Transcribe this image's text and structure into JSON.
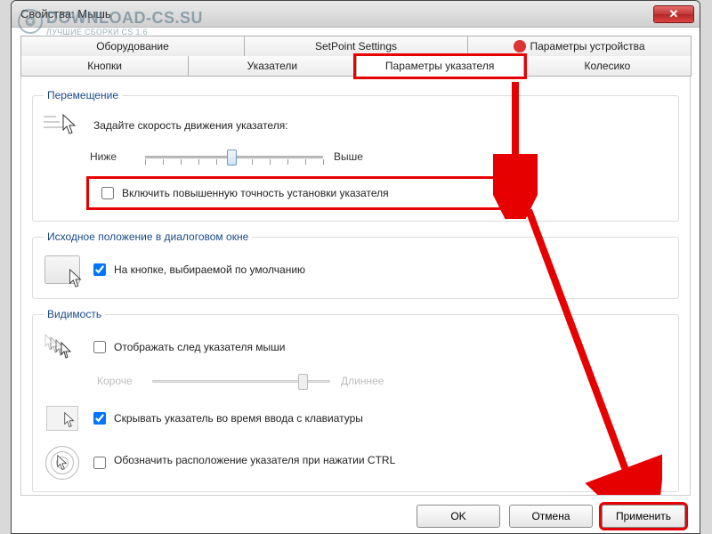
{
  "watermark": {
    "main": "DOWNLOAD-CS.SU",
    "sub": "ЛУЧШИЕ СБОРКИ CS 1.6"
  },
  "window": {
    "title": "Свойства: Мышь"
  },
  "tabs_row1": [
    {
      "label": "Оборудование"
    },
    {
      "label": "SetPoint Settings"
    },
    {
      "label": "Параметры устройства",
      "icon": true
    }
  ],
  "tabs_row2": [
    {
      "label": "Кнопки"
    },
    {
      "label": "Указатели"
    },
    {
      "label": "Параметры указателя",
      "active": true,
      "highlight": true
    },
    {
      "label": "Колесико"
    }
  ],
  "movement": {
    "legend": "Перемещение",
    "desc": "Задайте скорость движения указателя:",
    "low": "Ниже",
    "high": "Выше",
    "precision_label": "Включить повышенную точность установки указателя",
    "precision_checked": false
  },
  "snap": {
    "legend": "Исходное положение в диалоговом окне",
    "label": "На кнопке, выбираемой по умолчанию",
    "checked": true
  },
  "visibility": {
    "legend": "Видимость",
    "trail_label": "Отображать след указателя мыши",
    "trail_checked": false,
    "trail_low": "Короче",
    "trail_high": "Длиннее",
    "hide_label": "Скрывать указатель во время ввода с клавиатуры",
    "hide_checked": true,
    "locate_label": "Обозначить расположение указателя при нажатии CTRL",
    "locate_checked": false
  },
  "buttons": {
    "ok": "OK",
    "cancel": "Отмена",
    "apply": "Применить"
  }
}
